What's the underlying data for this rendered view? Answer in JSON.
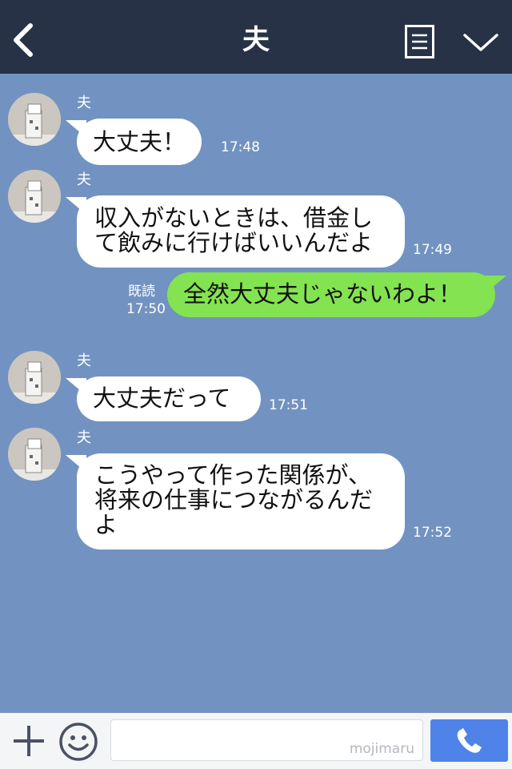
{
  "header": {
    "title": "夫",
    "back_icon": "chevron-left-icon",
    "menu_icon": "menu-list-icon",
    "dropdown_icon": "chevron-down-icon"
  },
  "messages": [
    {
      "sender": "夫",
      "text": "大丈夫！",
      "time": "17:48"
    },
    {
      "sender": "夫",
      "text": "収入がないときは、借金して飲みに行けばいいんだよ",
      "line1": "収入がないときは、借金し",
      "line2": "て飲みに行けばいいんだよ",
      "time": "17:49"
    },
    {
      "outgoing": true,
      "text": "全然大丈夫じゃないわよ！",
      "read": "既読",
      "time": "17:50"
    },
    {
      "sender": "夫",
      "text": "大丈夫だって",
      "time": "17:51"
    },
    {
      "sender": "夫",
      "text": "こうやって作った関係が、将来の仕事につながるんだよ",
      "line1": "こうやって作った関係が、",
      "line2": "将来の仕事につながるんだ",
      "line3": "よ",
      "time": "17:52"
    }
  ],
  "input": {
    "watermark": "mojimaru",
    "plus_icon": "plus-icon",
    "emoji_icon": "smiley-icon",
    "call_icon": "phone-icon"
  },
  "colors": {
    "header_bg": "#273246",
    "chat_bg": "#7293c1",
    "incoming_bubble": "#ffffff",
    "outgoing_bubble": "#84e351",
    "call_button": "#4f83ea"
  }
}
